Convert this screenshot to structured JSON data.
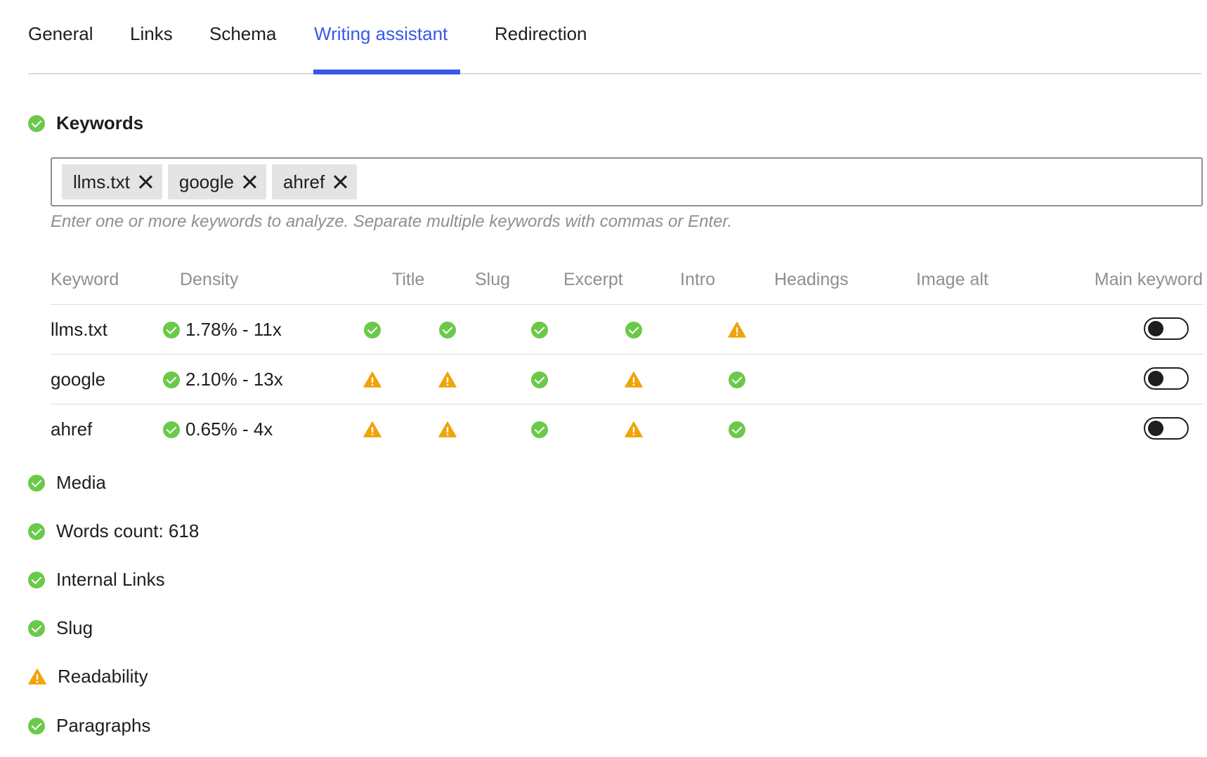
{
  "tabs": [
    {
      "label": "General"
    },
    {
      "label": "Links"
    },
    {
      "label": "Schema"
    },
    {
      "label": "Writing assistant",
      "active": true
    },
    {
      "label": "Redirection"
    }
  ],
  "keywords_section": {
    "title": "Keywords",
    "status": "ok",
    "chips": [
      "llms.txt",
      "google",
      "ahref"
    ],
    "input_value": "",
    "help_text": "Enter one or more keywords to analyze. Separate multiple keywords with commas or Enter."
  },
  "table": {
    "headers": [
      "Keyword",
      "Density",
      "Title",
      "Slug",
      "Excerpt",
      "Intro",
      "Headings",
      "Image alt",
      "Main keyword"
    ],
    "rows": [
      {
        "keyword": "llms.txt",
        "density": "1.78% - 11x",
        "density_status": "ok",
        "title": "ok",
        "slug": "ok",
        "excerpt": "ok",
        "intro": "ok",
        "headings": "warn",
        "image_alt": "",
        "main_keyword": false
      },
      {
        "keyword": "google",
        "density": "2.10% - 13x",
        "density_status": "ok",
        "title": "warn",
        "slug": "warn",
        "excerpt": "ok",
        "intro": "warn",
        "headings": "ok",
        "image_alt": "",
        "main_keyword": false
      },
      {
        "keyword": "ahref",
        "density": "0.65% - 4x",
        "density_status": "ok",
        "title": "warn",
        "slug": "warn",
        "excerpt": "ok",
        "intro": "warn",
        "headings": "ok",
        "image_alt": "",
        "main_keyword": false
      }
    ]
  },
  "checks": [
    {
      "label": "Media",
      "status": "ok"
    },
    {
      "label": "Words count: 618",
      "status": "ok"
    },
    {
      "label": "Internal Links",
      "status": "ok"
    },
    {
      "label": "Slug",
      "status": "ok"
    },
    {
      "label": "Readability",
      "status": "warn"
    },
    {
      "label": "Paragraphs",
      "status": "ok"
    }
  ],
  "colors": {
    "accent": "#3858e9",
    "ok": "#6bc94a",
    "warn": "#f0a30a",
    "muted": "#8c8f94"
  }
}
